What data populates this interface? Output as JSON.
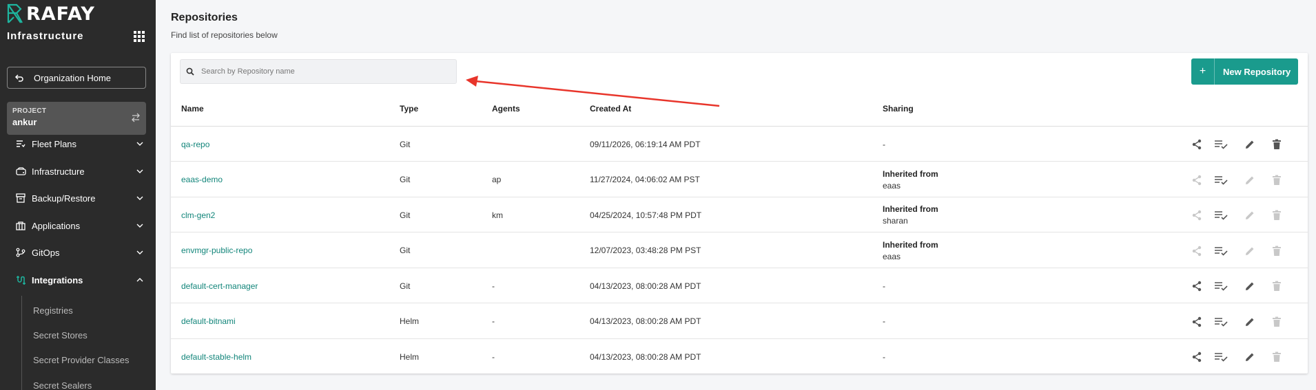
{
  "sidebar": {
    "brand": "RAFAY",
    "module_title": "Infrastructure",
    "org_home_label": "Organization Home",
    "project_caption": "PROJECT",
    "project_name": "ankur",
    "nav": [
      {
        "label": "Fleet Plans",
        "icon": "fleet-plans-icon"
      },
      {
        "label": "Infrastructure",
        "icon": "infrastructure-icon"
      },
      {
        "label": "Backup/Restore",
        "icon": "backup-icon"
      },
      {
        "label": "Applications",
        "icon": "applications-icon"
      },
      {
        "label": "GitOps",
        "icon": "gitops-icon"
      },
      {
        "label": "Integrations",
        "icon": "integrations-icon",
        "active": true
      }
    ],
    "subnav": [
      "Registries",
      "Secret Stores",
      "Secret Provider Classes",
      "Secret Sealers"
    ]
  },
  "page": {
    "title": "Repositories",
    "subtitle": "Find list of repositories below"
  },
  "search": {
    "placeholder": "Search by Repository name"
  },
  "new_repo_label": "New Repository",
  "table": {
    "headers": [
      "Name",
      "Type",
      "Agents",
      "Created At",
      "Sharing"
    ],
    "rows": [
      {
        "name": "qa-repo",
        "type": "Git",
        "agents": "",
        "created": "09/11/2026, 06:19:14 AM PDT",
        "sharing_title": "-",
        "sharing_sub": "",
        "enabled": true
      },
      {
        "name": "eaas-demo",
        "type": "Git",
        "agents": "ap",
        "created": "11/27/2024, 04:06:02 AM PST",
        "sharing_title": "Inherited from",
        "sharing_sub": "eaas",
        "enabled": false
      },
      {
        "name": "clm-gen2",
        "type": "Git",
        "agents": "km",
        "created": "04/25/2024, 10:57:48 PM PDT",
        "sharing_title": "Inherited from",
        "sharing_sub": "sharan",
        "enabled": false
      },
      {
        "name": "envmgr-public-repo",
        "type": "Git",
        "agents": "",
        "created": "12/07/2023, 03:48:28 PM PST",
        "sharing_title": "Inherited from",
        "sharing_sub": "eaas",
        "enabled": false
      },
      {
        "name": "default-cert-manager",
        "type": "Git",
        "agents": "-",
        "created": "04/13/2023, 08:00:28 AM PDT",
        "sharing_title": "-",
        "sharing_sub": "",
        "enabled": true,
        "delete_disabled": true
      },
      {
        "name": "default-bitnami",
        "type": "Helm",
        "agents": "-",
        "created": "04/13/2023, 08:00:28 AM PDT",
        "sharing_title": "-",
        "sharing_sub": "",
        "enabled": true,
        "delete_disabled": true
      },
      {
        "name": "default-stable-helm",
        "type": "Helm",
        "agents": "-",
        "created": "04/13/2023, 08:00:28 AM PDT",
        "sharing_title": "-",
        "sharing_sub": "",
        "enabled": true,
        "delete_disabled": true
      }
    ]
  },
  "colors": {
    "accent": "#1a9b8d",
    "link": "#12857a",
    "sidebar_bg": "#2b2b2b",
    "arrow": "#e8352b"
  }
}
